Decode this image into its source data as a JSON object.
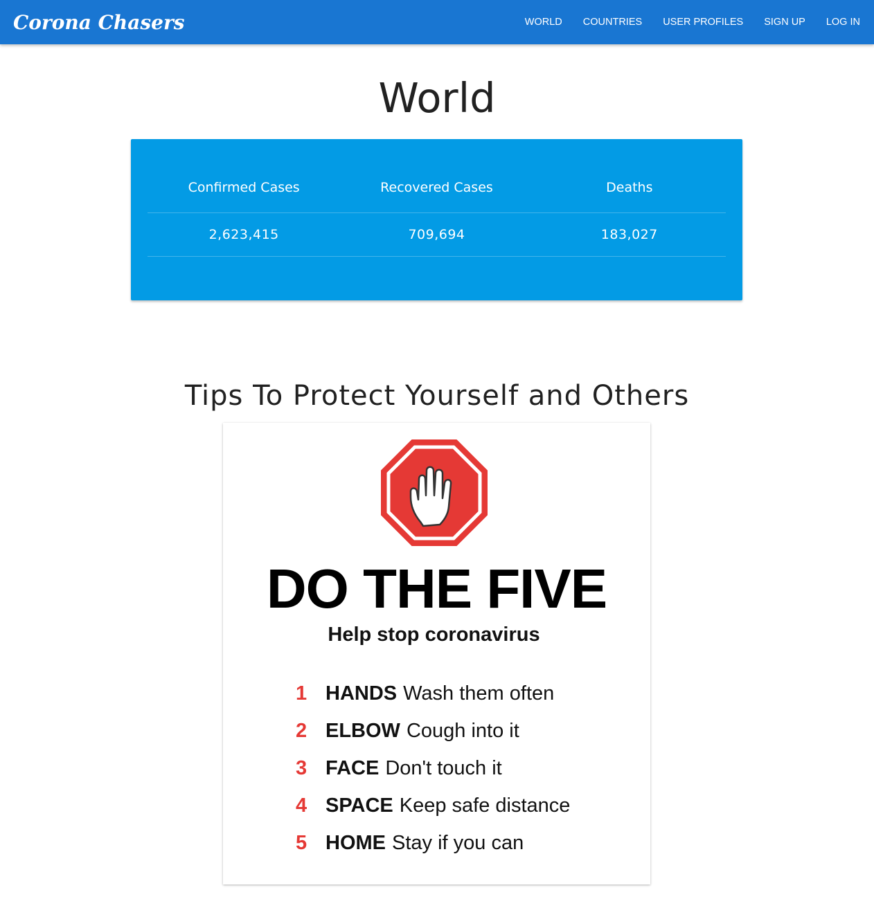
{
  "brand": "Corona Chasers",
  "nav": {
    "items": [
      "WORLD",
      "COUNTRIES",
      "USER PROFILES",
      "SIGN UP",
      "LOG IN"
    ]
  },
  "page": {
    "title": "World"
  },
  "stats": {
    "headers": [
      "Confirmed Cases",
      "Recovered Cases",
      "Deaths"
    ],
    "values": [
      "2,623,415",
      "709,694",
      "183,027"
    ]
  },
  "tips": {
    "title": "Tips To Protect Yourself and Others",
    "poster": {
      "headline": "DO THE FIVE",
      "subhead": "Help stop coronavirus",
      "items": [
        {
          "num": "1",
          "key": "HANDS",
          "text": "Wash them often"
        },
        {
          "num": "2",
          "key": "ELBOW",
          "text": "Cough into it"
        },
        {
          "num": "3",
          "key": "FACE",
          "text": "Don't touch it"
        },
        {
          "num": "4",
          "key": "SPACE",
          "text": "Keep safe distance"
        },
        {
          "num": "5",
          "key": "HOME",
          "text": "Stay if you can"
        }
      ],
      "icon": "stop-hand-icon"
    }
  },
  "colors": {
    "navbar": "#1976d2",
    "stats_card": "#039be5",
    "stop_red": "#e53935",
    "number_red": "#e53935"
  }
}
